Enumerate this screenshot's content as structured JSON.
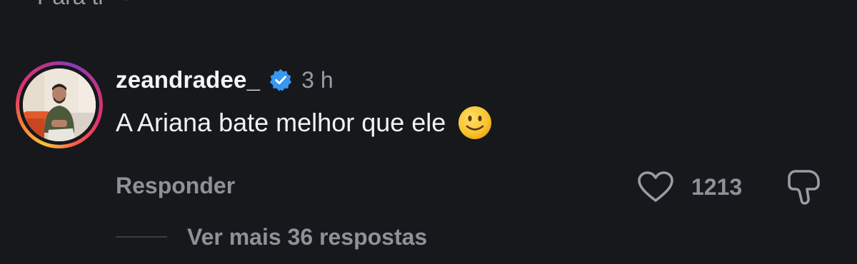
{
  "top_filter": {
    "label": "Para ti",
    "icon": "chevron-down-icon"
  },
  "comment": {
    "username": "zeandradee_",
    "verified": true,
    "verified_icon": "verified-badge-icon",
    "verified_color": "#3897f0",
    "timestamp": "3 h",
    "text": "A Ariana bate melhor que ele",
    "emoji": "slightly-smiling-face-emoji",
    "reply_label": "Responder",
    "like_count": "1213",
    "like_icon": "heart-icon",
    "dislike_icon": "dislike-icon",
    "view_replies_label": "Ver mais 36 respostas"
  },
  "colors": {
    "background": "#16181c",
    "primary_text": "#f2f2f2",
    "secondary_text": "#8f9198",
    "story_ring": [
      "#f9c33b",
      "#f77737",
      "#e1306c",
      "#c13584",
      "#8a3ab9"
    ]
  }
}
